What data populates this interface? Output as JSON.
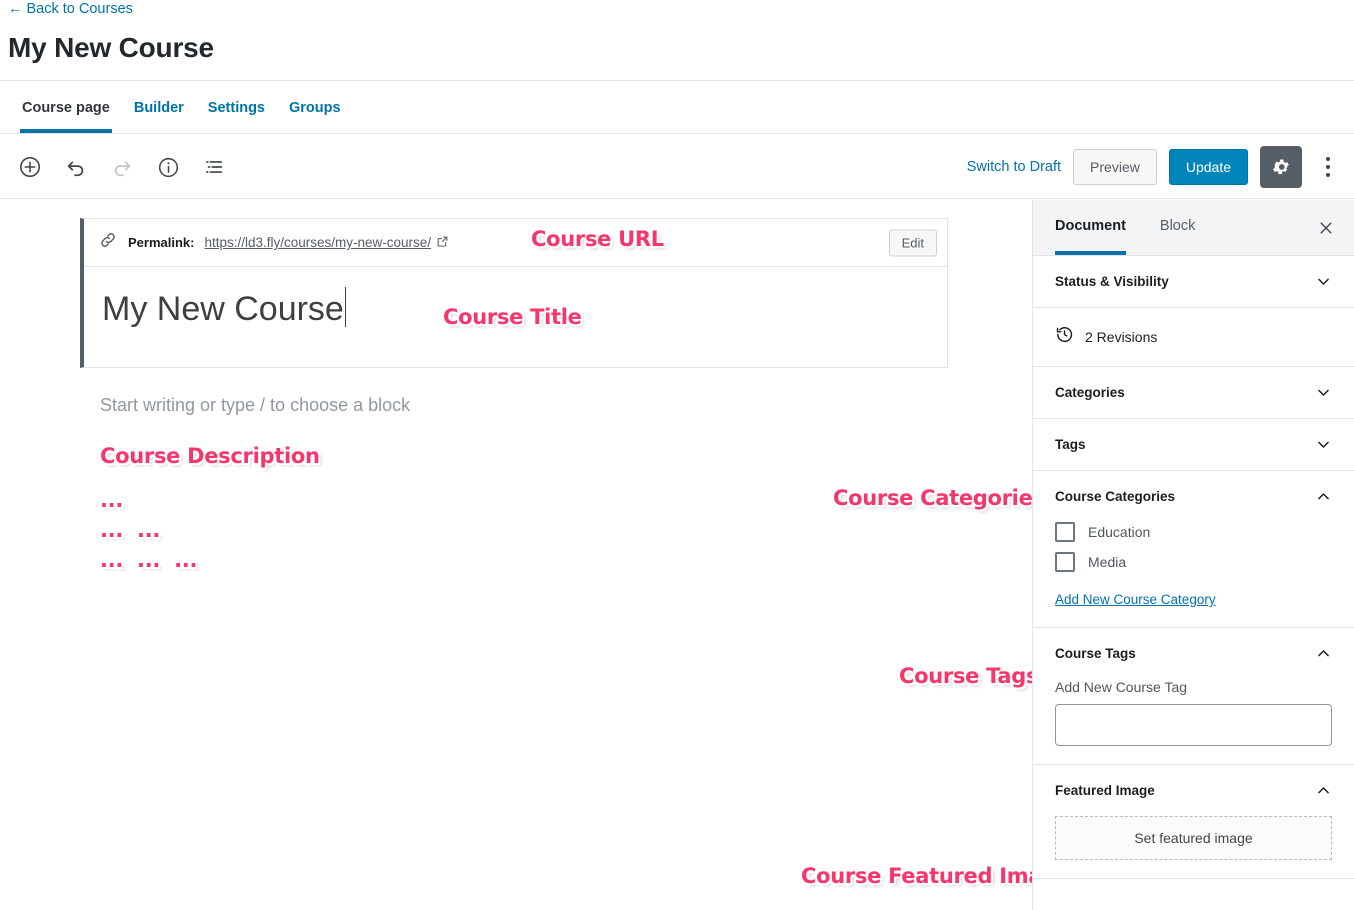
{
  "header": {
    "back_link": "Back to Courses",
    "back_arrow": "←",
    "title": "My New Course"
  },
  "tabs": [
    {
      "label": "Course page",
      "active": true
    },
    {
      "label": "Builder",
      "active": false
    },
    {
      "label": "Settings",
      "active": false
    },
    {
      "label": "Groups",
      "active": false
    }
  ],
  "toolbar": {
    "add_block_icon": "plus-circle-icon",
    "undo_icon": "undo-icon",
    "redo_icon": "redo-icon",
    "info_icon": "info-circle-icon",
    "list_view_icon": "list-view-icon",
    "switch_to_draft": "Switch to Draft",
    "preview": "Preview",
    "update": "Update",
    "settings_icon": "gear-icon",
    "more_icon": "ellipsis-vertical-icon"
  },
  "editor": {
    "permalink_label": "Permalink:",
    "permalink_url": "https://ld3.fly/courses/my-new-course/",
    "edit_button": "Edit",
    "title_value": "My New Course",
    "body_placeholder": "Start writing or type / to choose a block"
  },
  "annotations": {
    "course_url": "Course URL",
    "course_title": "Course Title",
    "course_description": "Course Description",
    "course_categories": "Course Categories",
    "course_tags": "Course Tags",
    "course_featured_image": "Course Featured Image",
    "ellipsis": "...",
    "color": "#f5376b"
  },
  "sidebar": {
    "tabs": [
      {
        "label": "Document",
        "active": true
      },
      {
        "label": "Block",
        "active": false
      }
    ],
    "close_icon": "close-icon",
    "panels": {
      "status_visibility": {
        "title": "Status & Visibility",
        "state": "collapsed"
      },
      "revisions": {
        "label": "2 Revisions",
        "icon": "revisions-clock-icon"
      },
      "categories": {
        "title": "Categories",
        "state": "collapsed"
      },
      "tags": {
        "title": "Tags",
        "state": "collapsed"
      },
      "course_categories": {
        "title": "Course Categories",
        "state": "expanded",
        "items": [
          {
            "label": "Education",
            "checked": false
          },
          {
            "label": "Media",
            "checked": false
          }
        ],
        "add_link": "Add New Course Category"
      },
      "course_tags": {
        "title": "Course Tags",
        "state": "expanded",
        "field_label": "Add New Course Tag",
        "field_value": "",
        "field_placeholder": ""
      },
      "featured_image": {
        "title": "Featured Image",
        "state": "expanded",
        "button": "Set featured image"
      }
    }
  }
}
